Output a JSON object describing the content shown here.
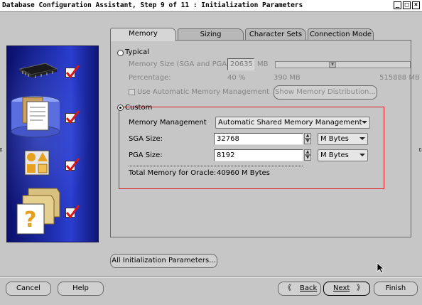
{
  "window": {
    "title": "Database Configuration Assistant, Step 9 of 11 : Initialization Parameters",
    "controls": [
      "_",
      "□",
      "×"
    ]
  },
  "tabs": [
    {
      "label": "Memory",
      "active": true
    },
    {
      "label": "Sizing",
      "active": false
    },
    {
      "label": "Character Sets",
      "active": false
    },
    {
      "label": "Connection Mode",
      "active": false
    }
  ],
  "typical": {
    "label": "Typical",
    "memory_size_label": "Memory Size (SGA and PGA):",
    "memory_size_value": "20635",
    "memory_size_unit": "MB",
    "percentage_label": "Percentage:",
    "percentage_value": "40 %",
    "slider_min": "390 MB",
    "slider_max": "515888 MB",
    "amm_checkbox_label": "Use Automatic Memory Management",
    "show_distribution_button": "Show Memory Distribution..."
  },
  "custom": {
    "label": "Custom",
    "memory_management_label": "Memory Management",
    "memory_management_value": "Automatic Shared Memory Management",
    "sga_label": "SGA Size:",
    "sga_value": "32768",
    "sga_unit": "M Bytes",
    "pga_label": "PGA Size:",
    "pga_value": "8192",
    "pga_unit": "M Bytes",
    "total_label": "Total Memory for Oracle:",
    "total_value": "40960 M Bytes"
  },
  "all_params_button": "All Initialization Parameters...",
  "footer": {
    "cancel": "Cancel",
    "help": "Help",
    "back": "Back",
    "next": "Next",
    "finish": "Finish"
  },
  "colors": {
    "highlight_box": "#e02020",
    "panel_blue": "#1c2ba8",
    "checkmark": "#d81818"
  }
}
